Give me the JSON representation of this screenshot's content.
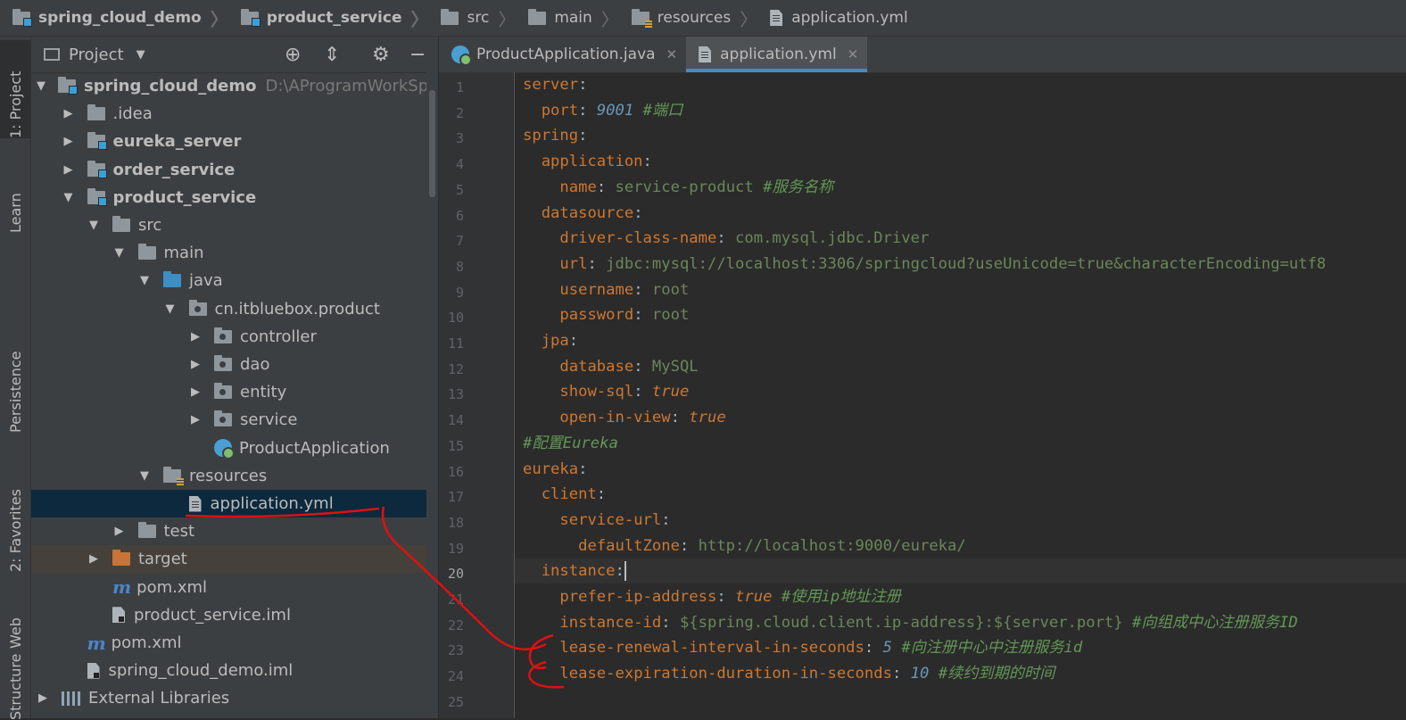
{
  "breadcrumb": [
    "spring_cloud_demo",
    "product_service",
    "src",
    "main",
    "resources",
    "application.yml"
  ],
  "side_tabs": [
    "1: Project",
    "Learn",
    "Persistence",
    "2: Favorites",
    "Web",
    "Structure"
  ],
  "project": {
    "title": "Project",
    "tree": [
      {
        "label": "spring_cloud_demo",
        "path": "D:\\AProgramWorkSpace\\ide",
        "icon": "module-folder-icon",
        "level": 0,
        "arrow": "▼",
        "bold": true
      },
      {
        "label": ".idea",
        "icon": "folder-icon",
        "level": 1,
        "arrow": "▶"
      },
      {
        "label": "eureka_server",
        "icon": "module-folder-icon",
        "level": 1,
        "arrow": "▶",
        "bold": true
      },
      {
        "label": "order_service",
        "icon": "module-folder-icon",
        "level": 1,
        "arrow": "▶",
        "bold": true
      },
      {
        "label": "product_service",
        "icon": "module-folder-icon",
        "level": 1,
        "arrow": "▼",
        "bold": true
      },
      {
        "label": "src",
        "icon": "folder-icon",
        "level": 2,
        "arrow": "▼"
      },
      {
        "label": "main",
        "icon": "folder-icon",
        "level": 3,
        "arrow": "▼"
      },
      {
        "label": "java",
        "icon": "source-folder-icon",
        "level": 4,
        "arrow": "▼"
      },
      {
        "label": "cn.itbluebox.product",
        "icon": "package-icon",
        "level": 5,
        "arrow": "▼"
      },
      {
        "label": "controller",
        "icon": "package-icon",
        "level": 6,
        "arrow": "▶"
      },
      {
        "label": "dao",
        "icon": "package-icon",
        "level": 6,
        "arrow": "▶"
      },
      {
        "label": "entity",
        "icon": "package-icon",
        "level": 6,
        "arrow": "▶"
      },
      {
        "label": "service",
        "icon": "package-icon",
        "level": 6,
        "arrow": "▶"
      },
      {
        "label": "ProductApplication",
        "icon": "spring-boot-app-icon",
        "level": 6,
        "arrow": ""
      },
      {
        "label": "resources",
        "icon": "resources-folder-icon",
        "level": 4,
        "arrow": "▼"
      },
      {
        "label": "application.yml",
        "icon": "yaml-file-icon",
        "level": 5,
        "arrow": "",
        "selected": true
      },
      {
        "label": "test",
        "icon": "folder-icon",
        "level": 3,
        "arrow": "▶"
      },
      {
        "label": "target",
        "icon": "excluded-folder-icon",
        "level": 2,
        "arrow": "▶",
        "excluded": true
      },
      {
        "label": "pom.xml",
        "icon": "maven-icon",
        "level": 2,
        "arrow": ""
      },
      {
        "label": "product_service.iml",
        "icon": "iml-file-icon",
        "level": 2,
        "arrow": ""
      },
      {
        "label": "pom.xml",
        "icon": "maven-icon",
        "level": 1,
        "arrow": ""
      },
      {
        "label": "spring_cloud_demo.iml",
        "icon": "iml-file-icon",
        "level": 1,
        "arrow": ""
      },
      {
        "label": "External Libraries",
        "icon": "libraries-icon",
        "level": 0,
        "arrow": "▶"
      }
    ]
  },
  "tabs": [
    {
      "label": "ProductApplication.java",
      "icon": "spring-boot-app-icon",
      "active": false
    },
    {
      "label": "application.yml",
      "icon": "yaml-file-icon",
      "active": true
    }
  ],
  "editor": {
    "current_line": 20,
    "lines": [
      [
        [
          "k",
          "server"
        ],
        [
          "p",
          ":"
        ]
      ],
      [
        [
          "p",
          "  "
        ],
        [
          "k",
          "port"
        ],
        [
          "p",
          ": "
        ],
        [
          "n",
          "9001"
        ],
        [
          "p",
          " "
        ],
        [
          "c",
          "#端口"
        ]
      ],
      [
        [
          "k",
          "spring"
        ],
        [
          "p",
          ":"
        ]
      ],
      [
        [
          "p",
          "  "
        ],
        [
          "k",
          "application"
        ],
        [
          "p",
          ":"
        ]
      ],
      [
        [
          "p",
          "    "
        ],
        [
          "k",
          "name"
        ],
        [
          "p",
          ": "
        ],
        [
          "s",
          "service-product"
        ],
        [
          "p",
          " "
        ],
        [
          "c",
          "#服务名称"
        ]
      ],
      [
        [
          "p",
          "  "
        ],
        [
          "k",
          "datasource"
        ],
        [
          "p",
          ":"
        ]
      ],
      [
        [
          "p",
          "    "
        ],
        [
          "k",
          "driver-class-name"
        ],
        [
          "p",
          ": "
        ],
        [
          "s",
          "com.mysql.jdbc.Driver"
        ]
      ],
      [
        [
          "p",
          "    "
        ],
        [
          "k",
          "url"
        ],
        [
          "p",
          ": "
        ],
        [
          "s",
          "jdbc:mysql://localhost:3306/springcloud?useUnicode=true&characterEncoding=utf8"
        ]
      ],
      [
        [
          "p",
          "    "
        ],
        [
          "k",
          "username"
        ],
        [
          "p",
          ": "
        ],
        [
          "s",
          "root"
        ]
      ],
      [
        [
          "p",
          "    "
        ],
        [
          "k",
          "password"
        ],
        [
          "p",
          ": "
        ],
        [
          "s",
          "root"
        ]
      ],
      [
        [
          "p",
          "  "
        ],
        [
          "k",
          "jpa"
        ],
        [
          "p",
          ":"
        ]
      ],
      [
        [
          "p",
          "    "
        ],
        [
          "k",
          "database"
        ],
        [
          "p",
          ": "
        ],
        [
          "s",
          "MySQL"
        ]
      ],
      [
        [
          "p",
          "    "
        ],
        [
          "k",
          "show-sql"
        ],
        [
          "p",
          ": "
        ],
        [
          "b",
          "true"
        ]
      ],
      [
        [
          "p",
          "    "
        ],
        [
          "k",
          "open-in-view"
        ],
        [
          "p",
          ": "
        ],
        [
          "b",
          "true"
        ]
      ],
      [
        [
          "c",
          "#配置Eureka"
        ]
      ],
      [
        [
          "k",
          "eureka"
        ],
        [
          "p",
          ":"
        ]
      ],
      [
        [
          "p",
          "  "
        ],
        [
          "k",
          "client"
        ],
        [
          "p",
          ":"
        ]
      ],
      [
        [
          "p",
          "    "
        ],
        [
          "k",
          "service-url"
        ],
        [
          "p",
          ":"
        ]
      ],
      [
        [
          "p",
          "      "
        ],
        [
          "k",
          "defaultZone"
        ],
        [
          "p",
          ": "
        ],
        [
          "s",
          "http://localhost:9000/eureka/"
        ]
      ],
      [
        [
          "p",
          "  "
        ],
        [
          "k",
          "instance"
        ],
        [
          "p",
          ":"
        ]
      ],
      [
        [
          "p",
          "    "
        ],
        [
          "k",
          "prefer-ip-address"
        ],
        [
          "p",
          ": "
        ],
        [
          "b",
          "true"
        ],
        [
          "p",
          " "
        ],
        [
          "c",
          "#使用ip地址注册"
        ]
      ],
      [
        [
          "p",
          "    "
        ],
        [
          "k",
          "instance-id"
        ],
        [
          "p",
          ": "
        ],
        [
          "s",
          "${spring.cloud.client.ip-address}:${server.port}"
        ],
        [
          "p",
          " "
        ],
        [
          "c",
          "#向组成中心注册服务ID"
        ]
      ],
      [
        [
          "p",
          "    "
        ],
        [
          "k",
          "lease-renewal-interval-in-seconds"
        ],
        [
          "p",
          ": "
        ],
        [
          "n",
          "5"
        ],
        [
          "p",
          " "
        ],
        [
          "c",
          "#向注册中心中注册服务id"
        ]
      ],
      [
        [
          "p",
          "    "
        ],
        [
          "k",
          "lease-expiration-duration-in-seconds"
        ],
        [
          "p",
          ": "
        ],
        [
          "n",
          "10"
        ],
        [
          "p",
          " "
        ],
        [
          "c",
          "#续约到期的时间"
        ]
      ],
      []
    ]
  },
  "colors": {
    "keyword": "#cc7832",
    "number": "#6897bb",
    "string": "#6a8759",
    "comment": "#629755",
    "annotation": "#e01010"
  }
}
